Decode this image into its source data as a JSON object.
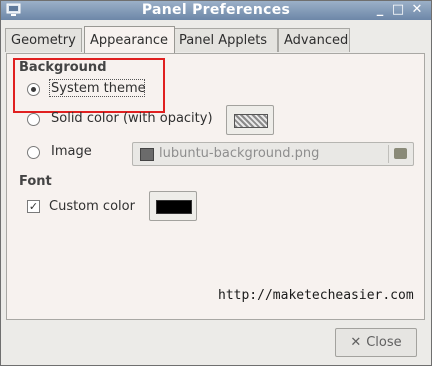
{
  "window": {
    "title": "Panel Preferences",
    "controls": {
      "minimize": "_",
      "maximize": "□",
      "close": "✕"
    }
  },
  "tabs": [
    {
      "label": "Geometry"
    },
    {
      "label": "Appearance",
      "selected": true
    },
    {
      "label": "Panel Applets"
    },
    {
      "label": "Advanced"
    }
  ],
  "background": {
    "section_label": "Background",
    "options": [
      {
        "label": "System theme",
        "selected": true
      },
      {
        "label": "Solid color (with opacity)",
        "selected": false
      },
      {
        "label": "Image",
        "selected": false
      }
    ],
    "image_file": "lubuntu-background.png"
  },
  "font": {
    "section_label": "Font",
    "custom_color_label": "Custom color",
    "custom_color_checked": true,
    "custom_color_value": "#000000",
    "check_mark": "✓"
  },
  "watermark": "http://maketecheasier.com",
  "footer": {
    "close_label": "Close",
    "close_icon": "✕"
  },
  "colors": {
    "highlight_box": "#e02020"
  }
}
